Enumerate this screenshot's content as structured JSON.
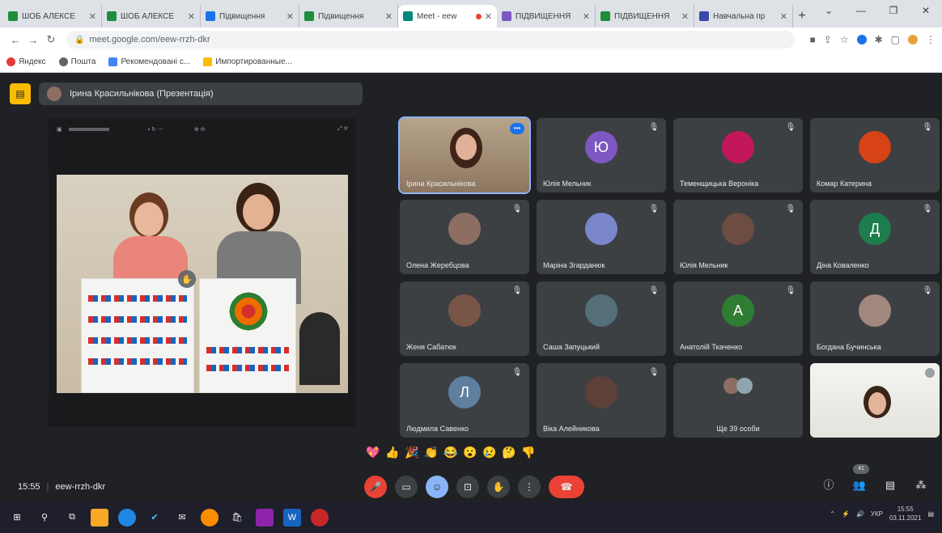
{
  "browser": {
    "tabs": [
      {
        "label": "ШОБ АЛЕКСЕ",
        "color": "#1e8e3e"
      },
      {
        "label": "ШОБ АЛЕКСЕ",
        "color": "#1e8e3e"
      },
      {
        "label": "Підвищення",
        "color": "#1a73e8"
      },
      {
        "label": "Підвищення",
        "color": "#1e8e3e"
      },
      {
        "label": "Meet - eew",
        "color": "#00897b",
        "active": true
      },
      {
        "label": "ПІДВИЩЕННЯ",
        "color": "#7e57c2"
      },
      {
        "label": "ПІДВИЩЕННЯ",
        "color": "#1e8e3e"
      },
      {
        "label": "Навчальна пр",
        "color": "#3949ab"
      }
    ],
    "url": "meet.google.com/eew-rrzh-dkr",
    "bookmarks": [
      "Яндекс",
      "Пошта",
      "Рекомендовані с...",
      "Импортированные..."
    ]
  },
  "meet": {
    "presenter_label": "Ірина Красильнікова (Презентація)",
    "tiles": [
      {
        "name": "Ірина Красильнікова",
        "type": "video",
        "speaking": true
      },
      {
        "name": "Юлія Мельник",
        "type": "letter",
        "letter": "Ю",
        "color": "#7e57c2"
      },
      {
        "name": "Теменщицька Вероніка",
        "type": "photo",
        "color": "#c2185b"
      },
      {
        "name": "Комар Катерина",
        "type": "photo",
        "color": "#d84315"
      },
      {
        "name": "Олена Жеребцова",
        "type": "photo",
        "color": "#8d6e63"
      },
      {
        "name": "Маріна Згарданюк",
        "type": "photo",
        "color": "#7986cb"
      },
      {
        "name": "Юлія Мельник",
        "type": "photo",
        "color": "#6d4c41"
      },
      {
        "name": "Діна Коваленко",
        "type": "letter",
        "letter": "Д",
        "color": "#1e7d4c"
      },
      {
        "name": "Женя Сабатюк",
        "type": "photo",
        "color": "#795548"
      },
      {
        "name": "Саша Запуцький",
        "type": "photo",
        "color": "#546e7a"
      },
      {
        "name": "Анатолій Ткаченко",
        "type": "letter",
        "letter": "А",
        "color": "#2e7d32"
      },
      {
        "name": "Богдана Бучинська",
        "type": "photo",
        "color": "#a1887f"
      },
      {
        "name": "Людмила Савенко",
        "type": "letter",
        "letter": "Л",
        "color": "#5f7f9f"
      },
      {
        "name": "Віка Алейникова",
        "type": "photo",
        "color": "#5d4037"
      },
      {
        "name": "Ще 39 особи",
        "type": "others"
      },
      {
        "name": "",
        "type": "selfview"
      }
    ],
    "reactions": [
      "💖",
      "👍",
      "🎉",
      "👏",
      "😂",
      "😮",
      "😢",
      "🤔",
      "👎"
    ],
    "time": "15:55",
    "meeting_code": "eew-rrzh-dkr",
    "participants_badge": "41"
  },
  "taskbar": {
    "lang": "УКР",
    "time": "15:55",
    "date": "03.11.2021"
  }
}
